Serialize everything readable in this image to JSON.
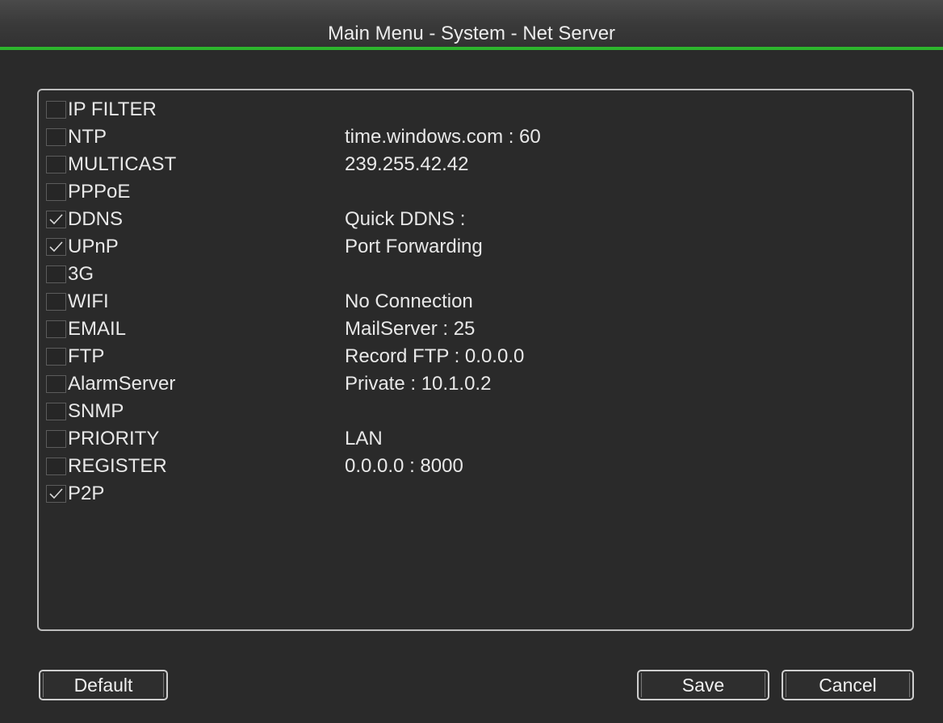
{
  "window": {
    "title": "Main Menu - System - Net Server"
  },
  "services": [
    {
      "name": "IP FILTER",
      "checked": false,
      "value": ""
    },
    {
      "name": "NTP",
      "checked": false,
      "value": "time.windows.com : 60"
    },
    {
      "name": "MULTICAST",
      "checked": false,
      "value": "239.255.42.42"
    },
    {
      "name": "PPPoE",
      "checked": false,
      "value": ""
    },
    {
      "name": "DDNS",
      "checked": true,
      "value": "Quick DDNS :"
    },
    {
      "name": "UPnP",
      "checked": true,
      "value": "Port Forwarding"
    },
    {
      "name": "3G",
      "checked": false,
      "value": ""
    },
    {
      "name": "WIFI",
      "checked": false,
      "value": "No Connection"
    },
    {
      "name": "EMAIL",
      "checked": false,
      "value": "MailServer : 25"
    },
    {
      "name": "FTP",
      "checked": false,
      "value": "Record FTP : 0.0.0.0"
    },
    {
      "name": "AlarmServer",
      "checked": false,
      "value": "Private : 10.1.0.2"
    },
    {
      "name": "SNMP",
      "checked": false,
      "value": ""
    },
    {
      "name": "PRIORITY",
      "checked": false,
      "value": "LAN"
    },
    {
      "name": "REGISTER",
      "checked": false,
      "value": "0.0.0.0 : 8000"
    },
    {
      "name": "P2P",
      "checked": true,
      "value": ""
    }
  ],
  "buttons": {
    "default": "Default",
    "save": "Save",
    "cancel": "Cancel"
  },
  "colors": {
    "accent": "#2db52d",
    "background": "#2a2a2a",
    "text": "#e8e8e8"
  }
}
